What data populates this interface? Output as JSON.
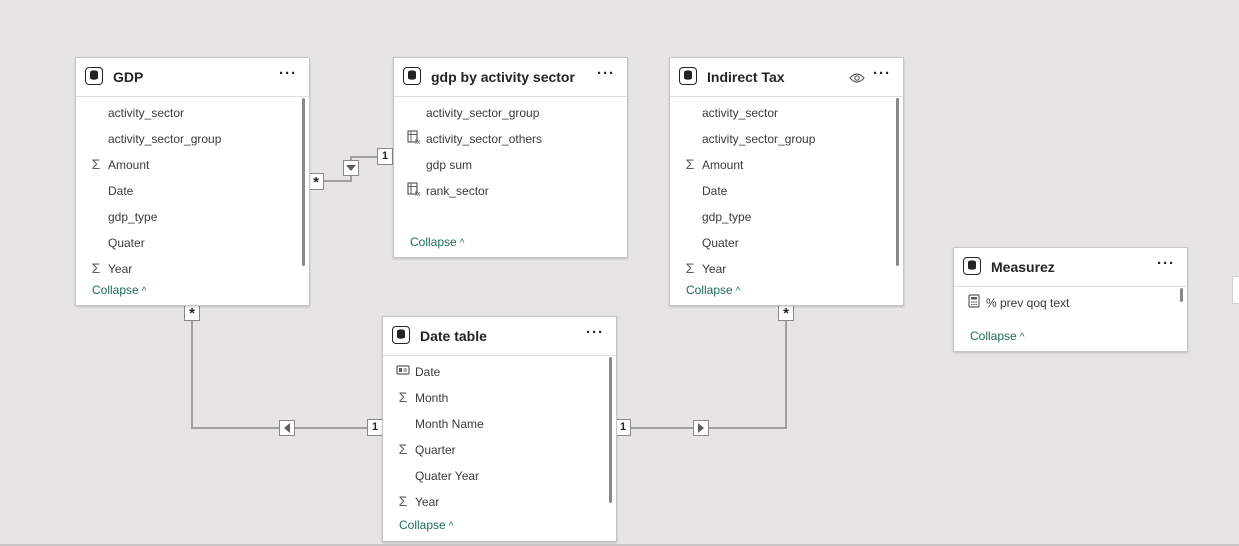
{
  "colors": {
    "canvas": "#e6e5e3",
    "link": "#a19f9d",
    "collapse_text": "#1f6b5a"
  },
  "tables": {
    "gdp": {
      "title": "GDP",
      "fields": [
        {
          "name": "activity_sector",
          "icon": ""
        },
        {
          "name": "activity_sector_group",
          "icon": ""
        },
        {
          "name": "Amount",
          "icon": "sigma-icon"
        },
        {
          "name": "Date",
          "icon": ""
        },
        {
          "name": "gdp_type",
          "icon": ""
        },
        {
          "name": "Quater",
          "icon": ""
        },
        {
          "name": "Year",
          "icon": "sigma-icon"
        }
      ],
      "collapse": "Collapse"
    },
    "gdp_by_sector": {
      "title": "gdp by activity sector",
      "fields": [
        {
          "name": "activity_sector_group",
          "icon": ""
        },
        {
          "name": "activity_sector_others",
          "icon": "calculated-column-icon"
        },
        {
          "name": "gdp sum",
          "icon": ""
        },
        {
          "name": "rank_sector",
          "icon": "calculated-column-icon"
        }
      ],
      "collapse": "Collapse"
    },
    "indirect_tax": {
      "title": "Indirect Tax",
      "fields": [
        {
          "name": "activity_sector",
          "icon": ""
        },
        {
          "name": "activity_sector_group",
          "icon": ""
        },
        {
          "name": "Amount",
          "icon": "sigma-icon"
        },
        {
          "name": "Date",
          "icon": ""
        },
        {
          "name": "gdp_type",
          "icon": ""
        },
        {
          "name": "Quater",
          "icon": ""
        },
        {
          "name": "Year",
          "icon": "sigma-icon"
        }
      ],
      "collapse": "Collapse"
    },
    "measurez": {
      "title": "Measurez",
      "fields": [
        {
          "name": "% prev qoq text",
          "icon": "calculator-icon"
        }
      ],
      "collapse": "Collapse"
    },
    "date_table": {
      "title": "Date table",
      "fields": [
        {
          "name": "Date",
          "icon": "id-card-icon"
        },
        {
          "name": "Month",
          "icon": "sigma-icon"
        },
        {
          "name": "Month Name",
          "icon": ""
        },
        {
          "name": "Quarter",
          "icon": "sigma-icon"
        },
        {
          "name": "Quater Year",
          "icon": ""
        },
        {
          "name": "Year",
          "icon": "sigma-icon"
        }
      ],
      "collapse": "Collapse"
    }
  },
  "cardinality": {
    "many": "*",
    "one": "1"
  },
  "menu_label": "···"
}
